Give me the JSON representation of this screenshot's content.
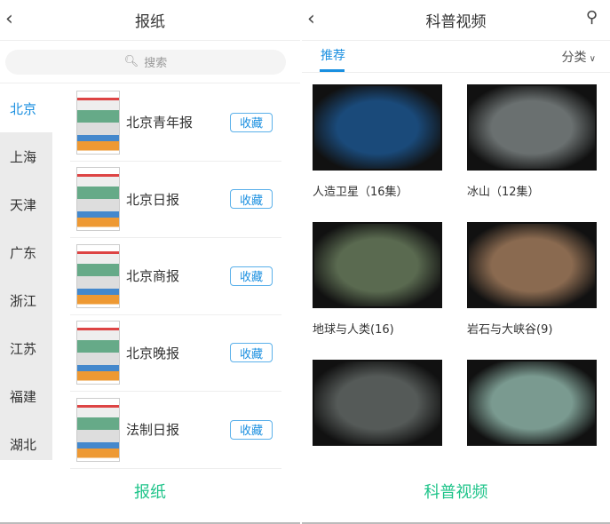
{
  "left": {
    "title": "报纸",
    "search_placeholder": "搜索",
    "provinces": [
      "北京",
      "上海",
      "天津",
      "广东",
      "浙江",
      "江苏",
      "福建",
      "湖北"
    ],
    "papers": [
      {
        "name": "北京青年报",
        "action": "收藏"
      },
      {
        "name": "北京日报",
        "action": "收藏"
      },
      {
        "name": "北京商报",
        "action": "收藏"
      },
      {
        "name": "北京晚报",
        "action": "收藏"
      },
      {
        "name": "法制日报",
        "action": "收藏"
      }
    ],
    "bottom_label": "报纸"
  },
  "right": {
    "title": "科普视频",
    "tab": "推荐",
    "category": "分类",
    "videos": [
      {
        "title": "人造卫星（16集）",
        "color": "#1a4a7a"
      },
      {
        "title": "冰山（12集）",
        "color": "#6a7070"
      },
      {
        "title": "地球与人类(16)",
        "color": "#5a6a50"
      },
      {
        "title": "岩石与大峡谷(9)",
        "color": "#8a6a50"
      },
      {
        "title": "",
        "color": "#555a58"
      },
      {
        "title": "",
        "color": "#7a9a90"
      }
    ],
    "bottom_label": "科普视频"
  },
  "colors": {
    "accent": "#1a8fe0",
    "green": "#1fc48a"
  }
}
